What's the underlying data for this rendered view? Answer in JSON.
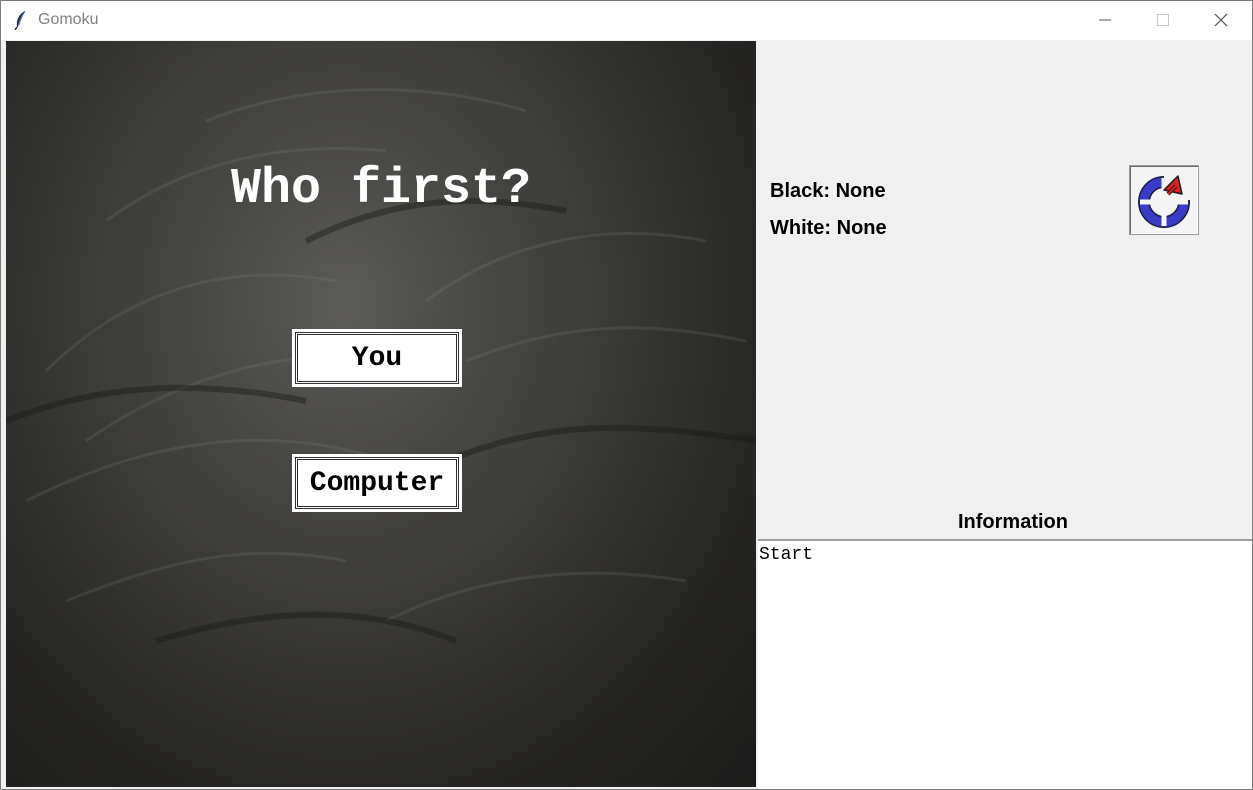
{
  "window": {
    "title": "Gomoku"
  },
  "board": {
    "prompt": "Who first?",
    "buttons": {
      "you": "You",
      "computer": "Computer"
    }
  },
  "side_panel": {
    "black_label": "Black: None",
    "white_label": "White: None",
    "reset_icon": "restart-icon",
    "info_title": "Information",
    "info_log": "Start"
  },
  "colors": {
    "board_background": "#2e2d2b",
    "panel_background": "#f0f0f0",
    "reset_arrow": "#e02020",
    "reset_ring": "#3838c0"
  }
}
